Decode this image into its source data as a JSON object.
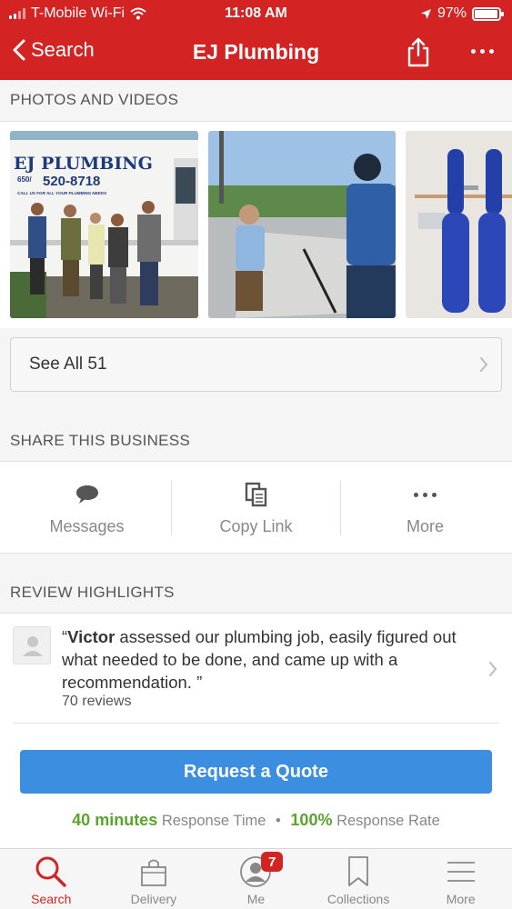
{
  "status_bar": {
    "carrier": "T-Mobile Wi-Fi",
    "time": "11:08 AM",
    "battery": "97%",
    "battery_level": 0.97
  },
  "nav": {
    "back_label": "Search",
    "title": "EJ Plumbing"
  },
  "photos": {
    "heading": "PHOTOS AND VIDEOS",
    "truck_sign": {
      "name": "EJ PLUMBING",
      "phone_prefix": "650/",
      "phone": "520-8718",
      "tagline": "CALL US FOR ALL YOUR PLUMBING NEEDS"
    },
    "see_all_label": "See All 51"
  },
  "share": {
    "heading": "SHARE THIS BUSINESS",
    "items": [
      {
        "label": "Messages",
        "icon": "speech-bubble-icon"
      },
      {
        "label": "Copy Link",
        "icon": "copy-icon"
      },
      {
        "label": "More",
        "icon": "more-dots-icon"
      }
    ]
  },
  "reviews": {
    "heading": "REVIEW HIGHLIGHTS",
    "highlight": {
      "highlight_word": "Victor",
      "text": " assessed our plumbing job, easily figured out what needed to be done, and came up with a recommendation.  ”",
      "open_quote": "“",
      "count": "70 reviews"
    }
  },
  "cta": {
    "label": "Request a Quote",
    "response_time_value": "40 minutes",
    "response_time_label": "Response Time",
    "separator": "•",
    "response_rate_value": "100%",
    "response_rate_label": "Response Rate"
  },
  "tabbar": {
    "items": [
      {
        "label": "Search",
        "icon": "search-icon",
        "active": true
      },
      {
        "label": "Delivery",
        "icon": "delivery-bag-icon"
      },
      {
        "label": "Me",
        "icon": "profile-icon",
        "badge": "7"
      },
      {
        "label": "Collections",
        "icon": "bookmark-icon"
      },
      {
        "label": "More",
        "icon": "menu-icon"
      }
    ]
  },
  "colors": {
    "brand_red": "#d32323",
    "cta_blue": "#3c8fe0",
    "response_green": "#5aa52e"
  }
}
